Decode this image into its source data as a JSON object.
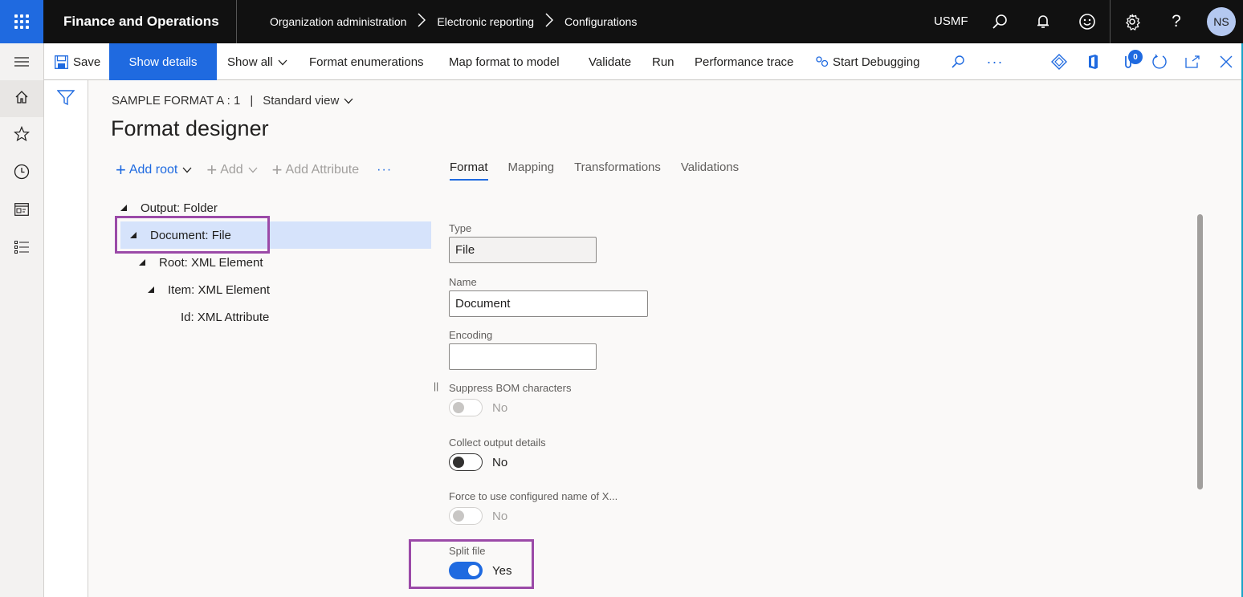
{
  "topbar": {
    "app_title": "Finance and Operations",
    "breadcrumb": [
      "Organization administration",
      "Electronic reporting",
      "Configurations"
    ],
    "company": "USMF",
    "avatar_initials": "NS",
    "icons": [
      "search-icon",
      "bell-icon",
      "smiley-icon",
      "gear-icon",
      "help-icon"
    ]
  },
  "actionpane": {
    "save": "Save",
    "show_details": "Show details",
    "show_all": "Show all",
    "format_enumerations": "Format enumerations",
    "map_format_to_model": "Map format to model",
    "validate": "Validate",
    "run": "Run",
    "performance_trace": "Performance trace",
    "start_debugging": "Start Debugging",
    "attachments_count": "0"
  },
  "leftnav": {
    "items": [
      "home",
      "favorites",
      "recent",
      "workspaces",
      "modules"
    ]
  },
  "record": {
    "name": "SAMPLE FORMAT A : 1",
    "separator": "|",
    "view": "Standard view"
  },
  "page": {
    "title": "Format designer"
  },
  "tree_toolbar": {
    "add_root": "Add root",
    "add": "Add",
    "add_attribute": "Add Attribute",
    "more": "···"
  },
  "tree": {
    "nodes": [
      {
        "label": "Output: Folder",
        "level": 0,
        "expanded": true,
        "selected": false
      },
      {
        "label": "Document: File",
        "level": 1,
        "expanded": true,
        "selected": true
      },
      {
        "label": "Root: XML Element",
        "level": 2,
        "expanded": true,
        "selected": false
      },
      {
        "label": "Item: XML Element",
        "level": 3,
        "expanded": true,
        "selected": false
      },
      {
        "label": "Id: XML Attribute",
        "level": 4,
        "expanded": false,
        "selected": false
      }
    ]
  },
  "tabs": [
    {
      "label": "Format",
      "active": true
    },
    {
      "label": "Mapping",
      "active": false
    },
    {
      "label": "Transformations",
      "active": false
    },
    {
      "label": "Validations",
      "active": false
    }
  ],
  "details": {
    "type_label": "Type",
    "type_value": "File",
    "name_label": "Name",
    "name_value": "Document",
    "encoding_label": "Encoding",
    "encoding_value": "",
    "suppress_bom_label": "Suppress BOM characters",
    "suppress_bom_value": "No",
    "collect_output_label": "Collect output details",
    "collect_output_value": "No",
    "force_name_label": "Force to use configured name of X...",
    "force_name_value": "No",
    "split_file_label": "Split file",
    "split_file_value": "Yes"
  },
  "colors": {
    "accent": "#1f6ae0",
    "highlight_box": "#9b4aa8",
    "selected_row": "#d6e3fb",
    "topbar": "#111111"
  }
}
